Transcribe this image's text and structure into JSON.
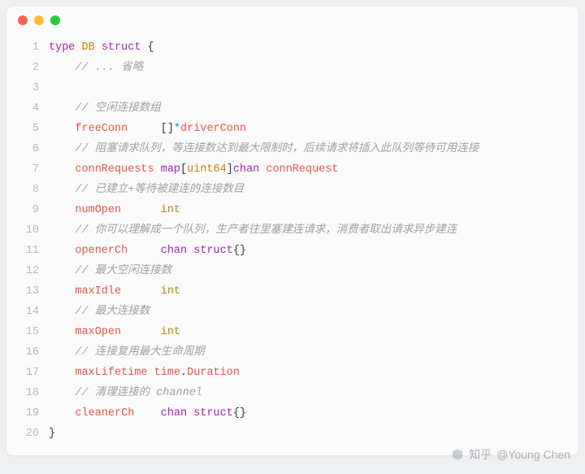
{
  "titlebar": {
    "dots": [
      "#ff5f56",
      "#ffbd2e",
      "#27c93f"
    ]
  },
  "code": {
    "lines": [
      {
        "n": 1,
        "tokens": [
          [
            "keyword",
            "type"
          ],
          [
            "plain",
            " "
          ],
          [
            "typename",
            "DB"
          ],
          [
            "plain",
            " "
          ],
          [
            "keyword",
            "struct"
          ],
          [
            "plain",
            " "
          ],
          [
            "brace",
            "{"
          ]
        ]
      },
      {
        "n": 2,
        "tokens": [
          [
            "plain",
            "    "
          ],
          [
            "comment",
            "// ... 省略"
          ]
        ]
      },
      {
        "n": 3,
        "tokens": []
      },
      {
        "n": 4,
        "tokens": [
          [
            "plain",
            "    "
          ],
          [
            "comment",
            "// 空闲连接数组"
          ]
        ]
      },
      {
        "n": 5,
        "tokens": [
          [
            "plain",
            "    "
          ],
          [
            "ident",
            "freeConn"
          ],
          [
            "plain",
            "     []"
          ],
          [
            "star",
            "*"
          ],
          [
            "ident",
            "driverConn"
          ]
        ]
      },
      {
        "n": 6,
        "tokens": [
          [
            "plain",
            "    "
          ],
          [
            "comment",
            "// 阻塞请求队列，等连接数达到最大限制时，后续请求将插入此队列等待可用连接"
          ]
        ]
      },
      {
        "n": 7,
        "tokens": [
          [
            "plain",
            "    "
          ],
          [
            "ident",
            "connRequests"
          ],
          [
            "plain",
            " "
          ],
          [
            "keyword",
            "map"
          ],
          [
            "punct",
            "["
          ],
          [
            "typename",
            "uint64"
          ],
          [
            "punct",
            "]"
          ],
          [
            "keyword",
            "chan"
          ],
          [
            "plain",
            " "
          ],
          [
            "ident",
            "connRequest"
          ]
        ]
      },
      {
        "n": 8,
        "tokens": [
          [
            "plain",
            "    "
          ],
          [
            "comment",
            "// 已建立+等待被建连的连接数目"
          ]
        ]
      },
      {
        "n": 9,
        "tokens": [
          [
            "plain",
            "    "
          ],
          [
            "ident",
            "numOpen"
          ],
          [
            "plain",
            "      "
          ],
          [
            "typename",
            "int"
          ]
        ]
      },
      {
        "n": 10,
        "tokens": [
          [
            "plain",
            "    "
          ],
          [
            "comment",
            "// 你可以理解成一个队列，生产者往里塞建连请求，消费者取出请求异步建连"
          ]
        ]
      },
      {
        "n": 11,
        "tokens": [
          [
            "plain",
            "    "
          ],
          [
            "ident",
            "openerCh"
          ],
          [
            "plain",
            "     "
          ],
          [
            "keyword",
            "chan"
          ],
          [
            "plain",
            " "
          ],
          [
            "keyword",
            "struct"
          ],
          [
            "brace",
            "{}"
          ]
        ]
      },
      {
        "n": 12,
        "tokens": [
          [
            "plain",
            "    "
          ],
          [
            "comment",
            "// 最大空闲连接数"
          ]
        ]
      },
      {
        "n": 13,
        "tokens": [
          [
            "plain",
            "    "
          ],
          [
            "ident",
            "maxIdle"
          ],
          [
            "plain",
            "      "
          ],
          [
            "typename",
            "int"
          ]
        ]
      },
      {
        "n": 14,
        "tokens": [
          [
            "plain",
            "    "
          ],
          [
            "comment",
            "// 最大连接数"
          ]
        ]
      },
      {
        "n": 15,
        "tokens": [
          [
            "plain",
            "    "
          ],
          [
            "ident",
            "maxOpen"
          ],
          [
            "plain",
            "      "
          ],
          [
            "typename",
            "int"
          ]
        ]
      },
      {
        "n": 16,
        "tokens": [
          [
            "plain",
            "    "
          ],
          [
            "comment",
            "// 连接复用最大生命周期"
          ]
        ]
      },
      {
        "n": 17,
        "tokens": [
          [
            "plain",
            "    "
          ],
          [
            "ident",
            "maxLifetime"
          ],
          [
            "plain",
            " "
          ],
          [
            "ident",
            "time"
          ],
          [
            "plain",
            "."
          ],
          [
            "ident",
            "Duration"
          ]
        ]
      },
      {
        "n": 18,
        "tokens": [
          [
            "plain",
            "    "
          ],
          [
            "comment",
            "// 清理连接的 channel"
          ]
        ]
      },
      {
        "n": 19,
        "tokens": [
          [
            "plain",
            "    "
          ],
          [
            "ident",
            "cleanerCh"
          ],
          [
            "plain",
            "    "
          ],
          [
            "keyword",
            "chan"
          ],
          [
            "plain",
            " "
          ],
          [
            "keyword",
            "struct"
          ],
          [
            "brace",
            "{}"
          ]
        ]
      },
      {
        "n": 20,
        "tokens": [
          [
            "brace",
            "}"
          ]
        ]
      }
    ]
  },
  "watermark": {
    "brand": "知乎",
    "author": "@Young Chen"
  }
}
